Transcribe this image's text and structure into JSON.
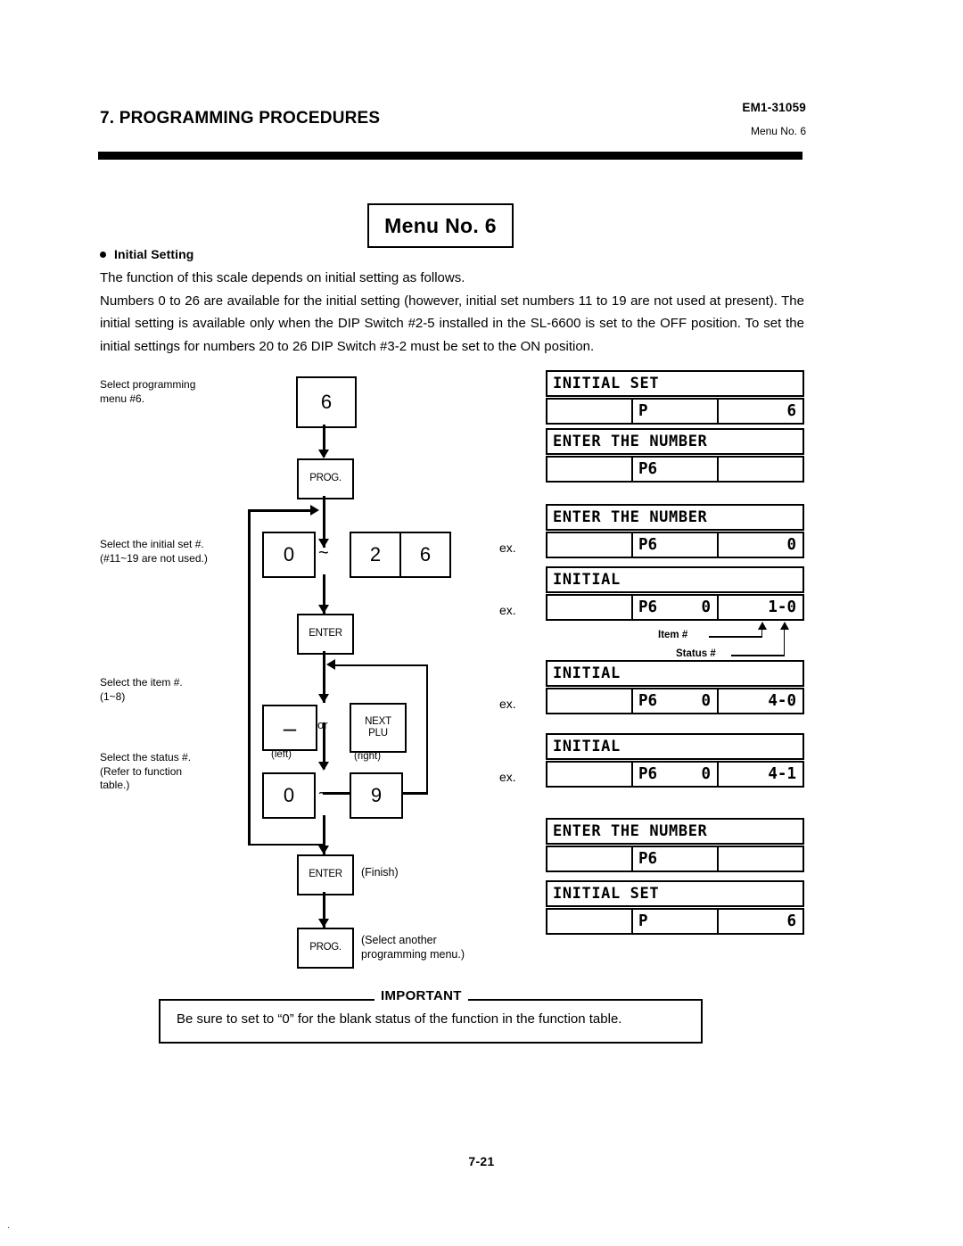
{
  "header": {
    "section_title": "7. PROGRAMMING PROCEDURES",
    "doc_code": "EM1-31059",
    "menu_ref": "Menu No. 6"
  },
  "menu_title": "Menu No. 6",
  "intro": {
    "heading": "Initial Setting",
    "line1": "The function of this scale depends on initial setting as follows.",
    "line2": "Numbers 0 to 26 are available for the initial setting (however, initial set numbers 11 to 19 are not used at present).   The initial setting is available only when the DIP Switch #2-5 installed in the SL-6600 is set to the OFF position.  To set the initial settings for numbers 20 to 26 DIP Switch #3-2 must be set to the ON position."
  },
  "flow": {
    "labels": {
      "step1": "Select programming\nmenu #6.",
      "step2": "Select the initial set #.\n(#11~19 are not used.)",
      "step3": "Select the item #.\n(1~8)",
      "step4": "Select the status #.\n(Refer to function\ntable.)"
    },
    "keys": {
      "menu6": "6",
      "prog": "PROG.",
      "range_low": "0",
      "range_high_tens": "2",
      "range_high_ones": "6",
      "tilde": "~",
      "enter1": "ENTER",
      "minus": "–",
      "next_plu_line1": "NEXT",
      "next_plu_line2": "PLU",
      "or": "or",
      "left_sub": "(left)",
      "right_sub": "(right)",
      "status_low": "0",
      "status_high": "9",
      "enter2": "ENTER",
      "prog2": "PROG."
    },
    "notes": {
      "finish": "(Finish)",
      "select_another": "(Select another\nprogramming menu.)"
    }
  },
  "displays": {
    "ex_label": "ex.",
    "annotations": {
      "item": "Item #",
      "status": "Status #"
    },
    "panels": [
      {
        "message": "INITIAL SET",
        "left": "",
        "mid_left": "P",
        "mid_right": "",
        "right": "6",
        "ex": false
      },
      {
        "message": "ENTER THE NUMBER",
        "left": "",
        "mid_left": "P6",
        "mid_right": "",
        "right": "",
        "ex": false
      },
      {
        "message": "ENTER THE NUMBER",
        "left": "",
        "mid_left": "P6",
        "mid_right": "",
        "right": "0",
        "ex": true
      },
      {
        "message": "INITIAL",
        "left": "",
        "mid_left": "P6",
        "mid_right": "0",
        "right": "1-0",
        "ex": true
      },
      {
        "message": "INITIAL",
        "left": "",
        "mid_left": "P6",
        "mid_right": "0",
        "right": "4-0",
        "ex": true
      },
      {
        "message": "INITIAL",
        "left": "",
        "mid_left": "P6",
        "mid_right": "0",
        "right": "4-1",
        "ex": true
      },
      {
        "message": "ENTER THE NUMBER",
        "left": "",
        "mid_left": "P6",
        "mid_right": "",
        "right": "",
        "ex": false
      },
      {
        "message": "INITIAL SET",
        "left": "",
        "mid_left": "P",
        "mid_right": "",
        "right": "6",
        "ex": false
      }
    ]
  },
  "important": {
    "label": "IMPORTANT",
    "text": "Be sure to set to “0” for the blank status of the function in the function table."
  },
  "footer": {
    "page_number": "7-21"
  }
}
